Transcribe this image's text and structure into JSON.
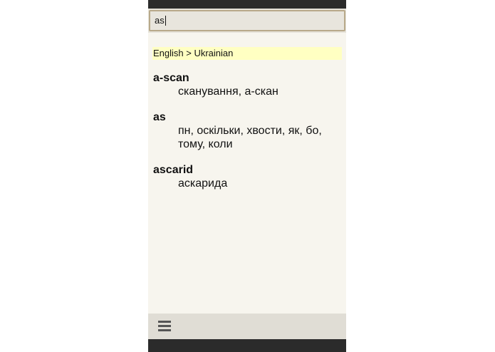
{
  "search": {
    "value": "as"
  },
  "dictionary": {
    "label": "English > Ukrainian"
  },
  "entries": [
    {
      "headword": "a-scan",
      "translation_lines": [
        "сканування, а-скан"
      ]
    },
    {
      "headword": "as",
      "translation_lines": [
        "пн, оскільки, хвости, як, бо,",
        "тому, коли"
      ]
    },
    {
      "headword": "ascarid",
      "translation_lines": [
        "аскарида"
      ]
    }
  ],
  "bottom_bar": {
    "menu_icon": "hamburger-menu-icon"
  },
  "colors": {
    "background": "#f7f5ee",
    "dictionary_label_bg": "#ffffc2",
    "search_border": "#b8a98a",
    "system_bars": "#2b2b2b"
  }
}
